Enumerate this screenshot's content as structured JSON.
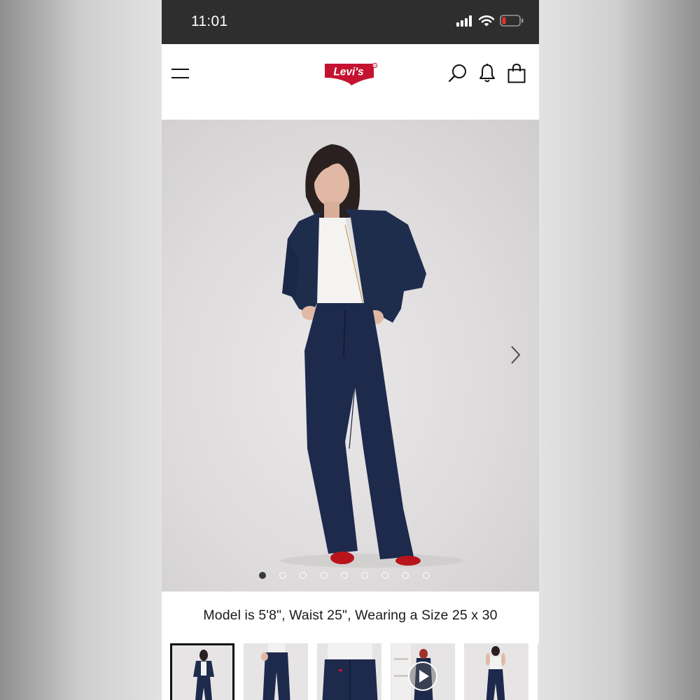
{
  "status_bar": {
    "time": "11:01",
    "icons": [
      "cellular-signal-icon",
      "wifi-icon",
      "battery-low-icon"
    ],
    "battery_color": "#e0322b"
  },
  "header": {
    "logo_text": "Levi's",
    "brand_color": "#c41230",
    "icons": [
      "menu-icon",
      "search-icon",
      "bell-icon",
      "shopping-bag-icon"
    ]
  },
  "gallery": {
    "image_count": 9,
    "active_index": 0,
    "next_icon": "chevron-right-icon"
  },
  "caption": "Model is 5'8\", Waist 25\", Wearing a Size 25 x 30",
  "thumbnails": [
    {
      "name": "thumbnail-front-full",
      "selected": true
    },
    {
      "name": "thumbnail-legs-front",
      "selected": false
    },
    {
      "name": "thumbnail-back-pockets",
      "selected": false
    },
    {
      "name": "thumbnail-video",
      "selected": false,
      "icon": "play-icon"
    },
    {
      "name": "thumbnail-back-full",
      "selected": false
    }
  ]
}
